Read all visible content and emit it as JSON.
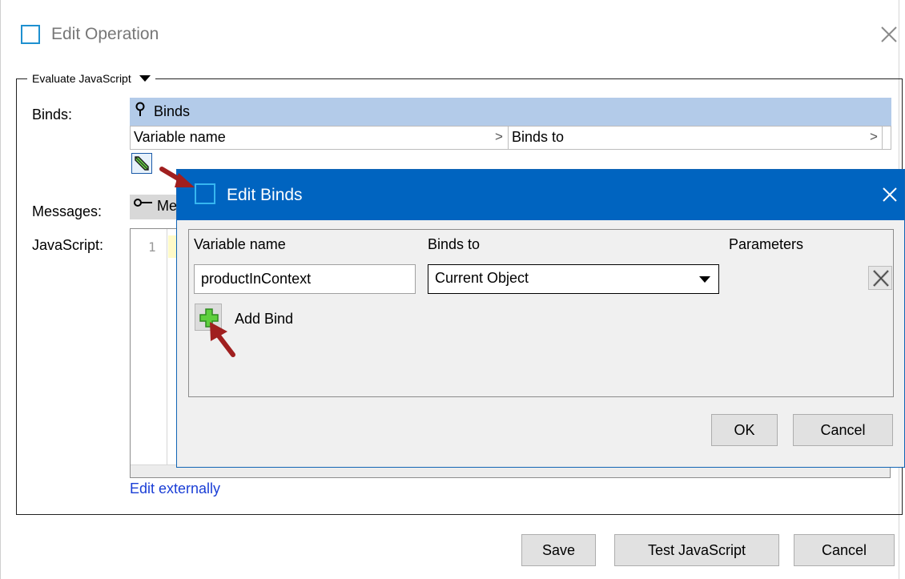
{
  "outer": {
    "title": "Edit Operation",
    "section": "Evaluate JavaScript",
    "binds_label": "Binds:",
    "messages_label": "Messages:",
    "javascript_label": "JavaScript:",
    "binds_header": "Binds",
    "columns": [
      "Variable name",
      "Binds to"
    ],
    "messages_header": "Me",
    "editor_line": "1",
    "edit_externally": "Edit externally",
    "buttons": {
      "save": "Save",
      "test": "Test JavaScript",
      "cancel": "Cancel"
    }
  },
  "inner": {
    "title": "Edit Binds",
    "headers": {
      "variable": "Variable name",
      "binds_to": "Binds to",
      "parameters": "Parameters"
    },
    "row": {
      "variable_value": "productInContext",
      "binds_to_value": "Current Object"
    },
    "add_bind": "Add Bind",
    "buttons": {
      "ok": "OK",
      "cancel": "Cancel"
    }
  },
  "colors": {
    "accent": "#0064c0",
    "header_highlight": "#b3cbe9",
    "annotation_arrow": "#a01f1f",
    "link": "#1a3ed6"
  }
}
